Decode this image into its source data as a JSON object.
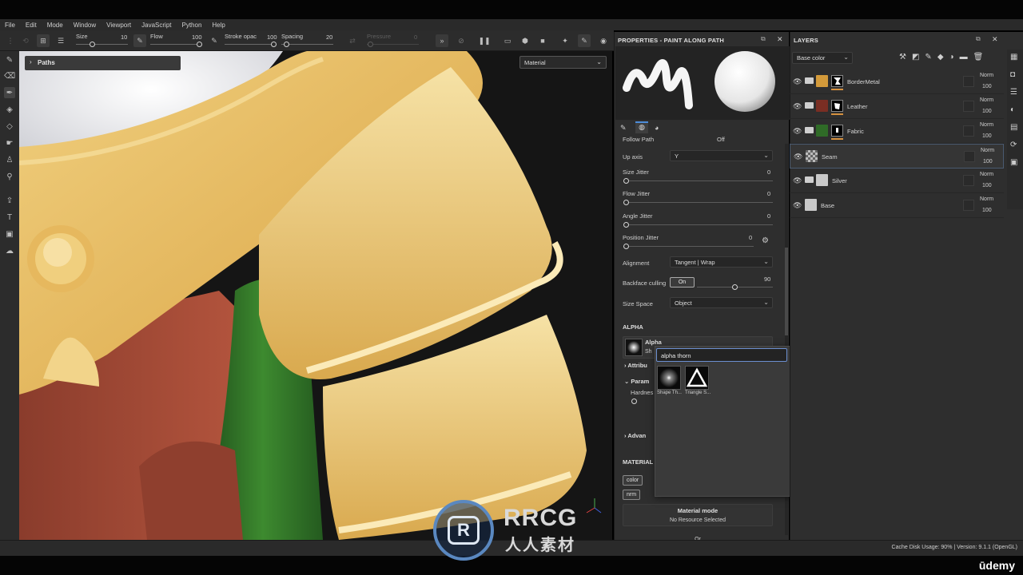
{
  "menu": [
    "File",
    "Edit",
    "Mode",
    "Window",
    "Viewport",
    "JavaScript",
    "Python",
    "Help"
  ],
  "toolbar": {
    "size_label": "Size",
    "size_value": "10",
    "flow_label": "Flow",
    "flow_value": "100",
    "stroke_label": "Stroke opac",
    "stroke_value": "100",
    "spacing_label": "Spacing",
    "spacing_value": "20",
    "pressure_label": "Pressure",
    "pressure_value": "0"
  },
  "viewport": {
    "paths_label": "Paths",
    "material_select": "Material"
  },
  "properties": {
    "title": "PROPERTIES - PAINT ALONG PATH",
    "follow_path_label": "Follow Path",
    "follow_path_value": "Off",
    "up_axis_label": "Up axis",
    "up_axis_value": "Y",
    "size_jitter_label": "Size Jitter",
    "size_jitter_value": "0",
    "flow_jitter_label": "Flow Jitter",
    "flow_jitter_value": "0",
    "angle_jitter_label": "Angle Jitter",
    "angle_jitter_value": "0",
    "position_jitter_label": "Position Jitter",
    "position_jitter_value": "0",
    "alignment_label": "Alignment",
    "alignment_value": "Tangent | Wrap",
    "backface_label": "Backface culling",
    "backface_toggle": "On",
    "backface_value": "90",
    "size_space_label": "Size Space",
    "size_space_value": "Object",
    "alpha_section": "ALPHA",
    "alpha_name": "Alpha",
    "alpha_sub": "Sh",
    "attrib_label": "Attribu",
    "param_label": "Param",
    "hardness_label": "Hardnes",
    "advanced_label": "Advan",
    "material_section": "MATERIAL",
    "chip_color": "color",
    "chip_nrm": "nrm",
    "material_mode_title": "Material mode",
    "material_mode_value": "No Resource Selected",
    "or_label": "Or"
  },
  "popup": {
    "search_value": "alpha thorn",
    "items": [
      {
        "label": "Shape Th..."
      },
      {
        "label": "Triangle S..."
      }
    ]
  },
  "layers": {
    "title": "LAYERS",
    "channel": "Base color",
    "rows": [
      {
        "name": "BorderMetal",
        "blend": "Norm",
        "opacity": "100",
        "color": "#d39a3a",
        "folder": true,
        "mask": true
      },
      {
        "name": "Leather",
        "blend": "Norm",
        "opacity": "100",
        "color": "#7a2e23",
        "folder": true,
        "mask": true
      },
      {
        "name": "Fabric",
        "blend": "Norm",
        "opacity": "100",
        "color": "#2f6b27",
        "folder": true,
        "mask": true
      },
      {
        "name": "Seam",
        "blend": "Norm",
        "opacity": "100",
        "color": "checker",
        "folder": false,
        "mask": false
      },
      {
        "name": "Silver",
        "blend": "Norm",
        "opacity": "100",
        "color": "#c9c9c9",
        "folder": true,
        "mask": false
      },
      {
        "name": "Base",
        "blend": "Norm",
        "opacity": "100",
        "color": "#c9c9c9",
        "folder": false,
        "mask": false
      }
    ]
  },
  "status": "Cache Disk Usage:   90% | Version: 9.1.1 (OpenGL)",
  "watermark": {
    "brand": "RRCG",
    "sub": "人人素材",
    "platform": "ūdemy"
  }
}
